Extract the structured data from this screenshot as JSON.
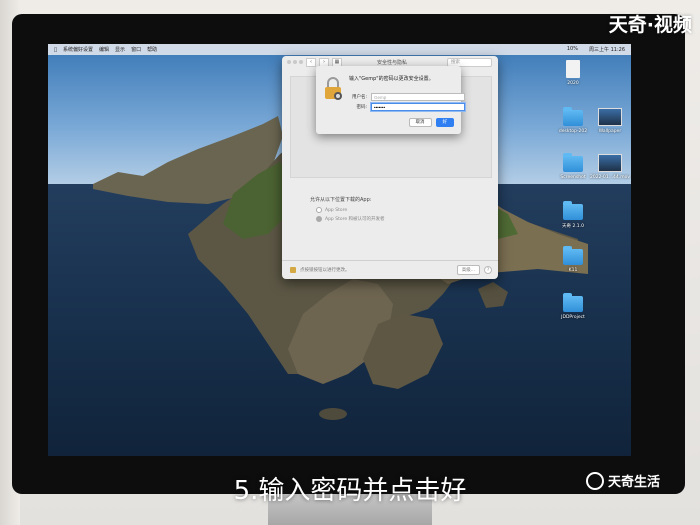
{
  "watermark_top": "天奇·视频",
  "watermark_bottom": "天奇生活",
  "caption": "5.输入密码并点击好",
  "menubar": {
    "apple": "",
    "items": [
      "系统偏好设置",
      "编辑",
      "显示",
      "窗口",
      "帮助"
    ],
    "status": [
      "10%",
      "周三上午 11:26"
    ]
  },
  "pref_window": {
    "title": "安全性与隐私",
    "search_placeholder": "搜索",
    "allow_heading": "允许从以下位置下载的App:",
    "options": [
      "App Store",
      "App Store 和被认可的开发者"
    ],
    "lock_text": "点按锁按钮以进行更改。",
    "advanced_button": "高级...",
    "help_button": "?"
  },
  "auth_dialog": {
    "message": "输入\"Gemp\"的密码以更改安全设置。",
    "username_label": "用户名:",
    "username_value": "Gemp",
    "password_label": "密码:",
    "password_value": "•••••••",
    "cancel_button": "取消",
    "ok_button": "好"
  },
  "desktop_icons": [
    {
      "label": "2020"
    },
    {
      "label": "desktop-202"
    },
    {
      "label": "Wallpaper"
    },
    {
      "label": "2022-01...44.mov"
    },
    {
      "label": "Screenshot"
    },
    {
      "label": "天奇 2.1.0"
    },
    {
      "label": "K11"
    },
    {
      "label": "JDDProject"
    }
  ]
}
